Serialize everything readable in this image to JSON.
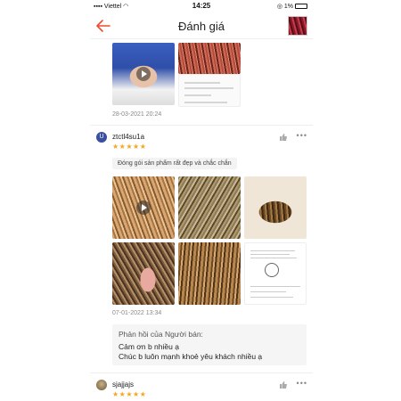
{
  "status_bar": {
    "carrier": "Viettel",
    "time": "14:25",
    "battery": "1%"
  },
  "header": {
    "title": "Đánh giá"
  },
  "review_prev": {
    "timestamp": "28-03-2021 20:24"
  },
  "review_main": {
    "username": "ztctl4su1a",
    "avatar_letter": "U",
    "stars": "★★★★★",
    "rating": 5,
    "tag": "Đóng gói sản phẩm rất đẹp và chắc chắn",
    "timestamp": "07-01-2022 13:34",
    "seller_reply": {
      "heading": "Phản hồi của Người bán:",
      "line1": "Cảm ơn b nhiều ạ",
      "line2": "Chúc b luôn mạnh khoẻ yêu khách nhiều ạ"
    }
  },
  "review_next": {
    "username": "sjajjajs",
    "stars": "★★★★★",
    "rating": 5
  },
  "colors": {
    "accent": "#ee4d2d",
    "star": "#f5a623",
    "avatar_main": "#3b4fa0"
  },
  "icons": [
    "back-arrow-icon",
    "play-icon",
    "thumbs-up-icon",
    "more-icon",
    "wifi-icon",
    "battery-icon"
  ]
}
